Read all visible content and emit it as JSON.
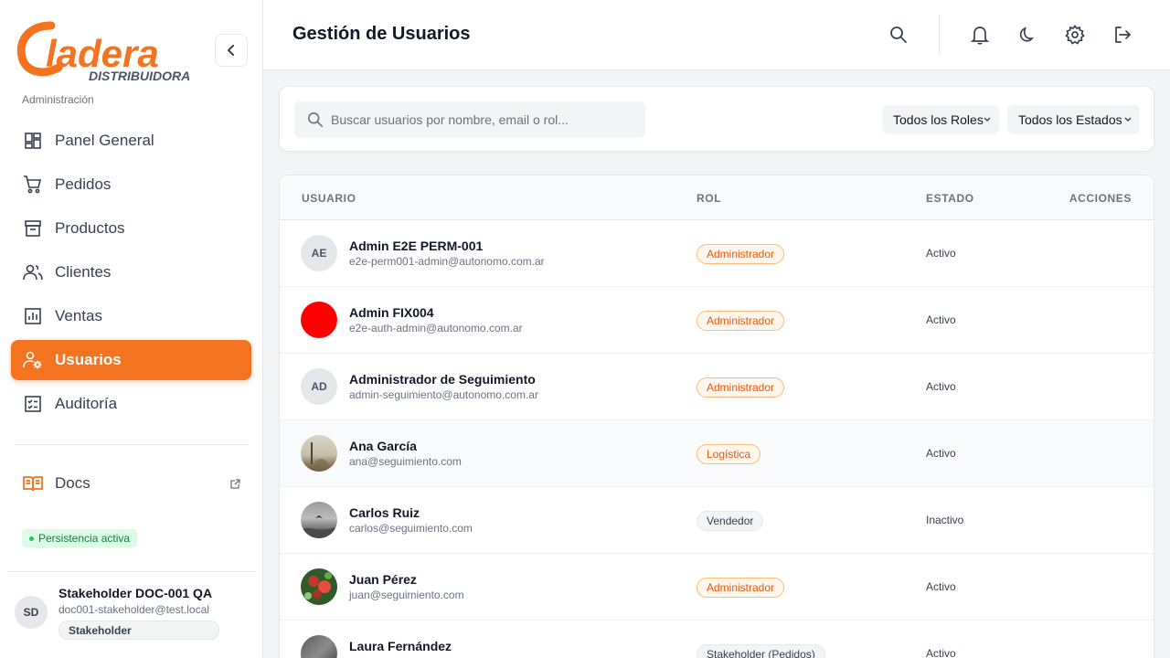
{
  "brand": {
    "logo_word": "Cladera",
    "logo_sub": "DISTRIBUIDORA",
    "color": "#f47320"
  },
  "sidebar": {
    "section_label": "Administración",
    "items": [
      {
        "label": "Panel General",
        "icon": "dashboard-icon"
      },
      {
        "label": "Pedidos",
        "icon": "cart-icon"
      },
      {
        "label": "Productos",
        "icon": "archive-icon"
      },
      {
        "label": "Clientes",
        "icon": "users-icon"
      },
      {
        "label": "Ventas",
        "icon": "chart-icon"
      },
      {
        "label": "Usuarios",
        "icon": "user-gear-icon",
        "active": true
      },
      {
        "label": "Auditoría",
        "icon": "checklist-icon"
      }
    ],
    "docs_label": "Docs",
    "persist_label": "Persistencia activa",
    "user": {
      "initials": "SD",
      "name": "Stakeholder DOC-001 QA",
      "email": "doc001-stakeholder@test.local",
      "role": "Stakeholder"
    }
  },
  "header": {
    "title": "Gestión de Usuarios"
  },
  "filters": {
    "search_placeholder": "Buscar usuarios por nombre, email o rol...",
    "roles_select": "Todos los Roles",
    "status_select": "Todos los Estados"
  },
  "table": {
    "columns": [
      "USUARIO",
      "ROL",
      "ESTADO",
      "ACCIONES"
    ],
    "rows": [
      {
        "initials": "AE",
        "avatar": "initials",
        "name": "Admin E2E PERM-001",
        "email": "e2e-perm001-admin@autonomo.com.ar",
        "role": "Administrador",
        "role_tone": "orange",
        "status": "Activo"
      },
      {
        "initials": "",
        "avatar": "red-dot",
        "name": "Admin FIX004",
        "email": "e2e-auth-admin@autonomo.com.ar",
        "role": "Administrador",
        "role_tone": "orange",
        "status": "Activo"
      },
      {
        "initials": "AD",
        "avatar": "initials",
        "name": "Administrador de Seguimiento",
        "email": "admin-seguimiento@autonomo.com.ar",
        "role": "Administrador",
        "role_tone": "orange",
        "status": "Activo"
      },
      {
        "initials": "",
        "avatar": "photo-beige",
        "name": "Ana García",
        "email": "ana@seguimiento.com",
        "role": "Logística",
        "role_tone": "orange",
        "status": "Activo"
      },
      {
        "initials": "",
        "avatar": "photo-gray",
        "name": "Carlos Ruiz",
        "email": "carlos@seguimiento.com",
        "role": "Vendedor",
        "role_tone": "gray",
        "status": "Inactivo"
      },
      {
        "initials": "",
        "avatar": "photo-flowers",
        "name": "Juan Pérez",
        "email": "juan@seguimiento.com",
        "role": "Administrador",
        "role_tone": "orange",
        "status": "Activo"
      },
      {
        "initials": "",
        "avatar": "photo-dark",
        "name": "Laura Fernández",
        "email": "",
        "role": "Stakeholder (Pedidos)",
        "role_tone": "gray",
        "status": "Activo"
      }
    ]
  }
}
